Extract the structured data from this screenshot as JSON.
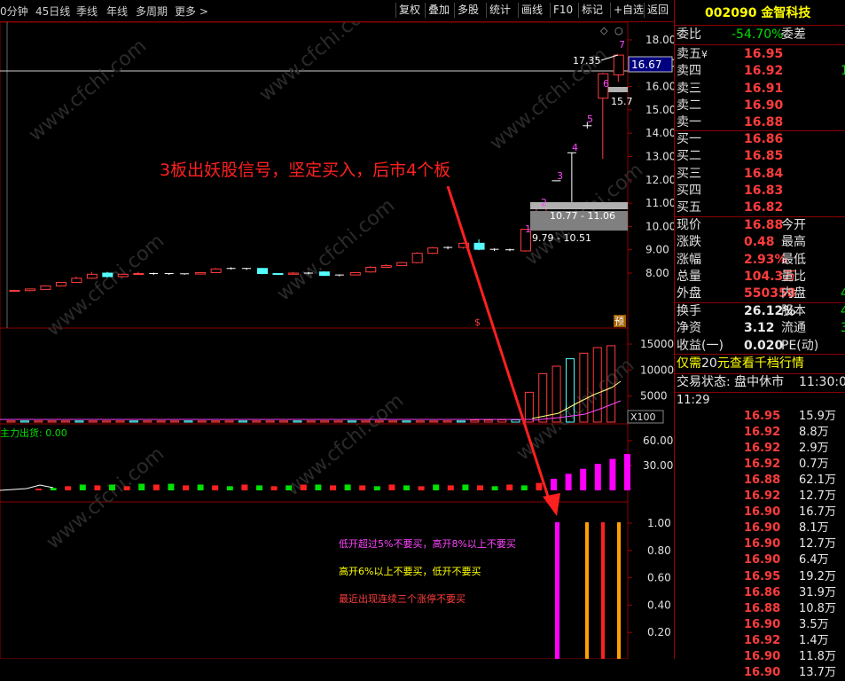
{
  "toolbar": {
    "left": [
      "0分钟",
      "45日线",
      "季线",
      "年线",
      "多周期",
      "更多"
    ],
    "right": [
      "复权",
      "叠加",
      "多股",
      "统计",
      "画线",
      "F10",
      "标记",
      "+自选",
      "返回"
    ]
  },
  "price_axis": [
    "18.00",
    "17.00",
    "16.00",
    "15.00",
    "14.00",
    "13.00",
    "12.00",
    "11.00",
    "10.00",
    "9.00",
    "8.00"
  ],
  "price_label": "16.67",
  "annotations": {
    "high_label": "17.35",
    "partial_label": "15.7",
    "box1": "10.77 - 11.06",
    "box2": "9.79 - 10.51",
    "nums": [
      "1",
      "2",
      "3",
      "4",
      "5",
      "6",
      "7"
    ],
    "main_text": "3板出妖股信号，坚定买入，后市4个板",
    "s_mark": "$",
    "yu_mark": "预"
  },
  "vol_axis": [
    "15000",
    "10000",
    "5000"
  ],
  "vol_unit": "X100",
  "flow_title": "主力出货: 0.00",
  "flow_axis": [
    "60.00",
    "30.00"
  ],
  "sig_axis": [
    "1.00",
    "0.80",
    "0.60",
    "0.40",
    "0.20"
  ],
  "notes": [
    "低开超过5%不要买，高开8%以上不要买",
    "高开6%以上不要买，低开不要买",
    "最近出现连续三个涨停不要买"
  ],
  "watermark": "www.cfchi.com",
  "stock": {
    "code": "002090",
    "name": "金智科技"
  },
  "weibi": {
    "label": "委比",
    "value": "-54.70%",
    "label2": "委差"
  },
  "asks": [
    {
      "label": "卖五",
      "mark": "¥",
      "price": "16.95"
    },
    {
      "label": "卖四",
      "price": "16.92",
      "extra": "1"
    },
    {
      "label": "卖三",
      "price": "16.91"
    },
    {
      "label": "卖二",
      "price": "16.90"
    },
    {
      "label": "卖一",
      "price": "16.88"
    }
  ],
  "bids": [
    {
      "label": "买一",
      "price": "16.86"
    },
    {
      "label": "买二",
      "price": "16.85"
    },
    {
      "label": "买三",
      "price": "16.84"
    },
    {
      "label": "买四",
      "price": "16.83"
    },
    {
      "label": "买五",
      "price": "16.82"
    }
  ],
  "quote": [
    {
      "l": "现价",
      "v": "16.88",
      "r": "今开"
    },
    {
      "l": "涨跌",
      "v": "0.48",
      "r": "最高"
    },
    {
      "l": "涨幅",
      "v": "2.93%",
      "r": "最低"
    },
    {
      "l": "总量",
      "v": "104.3万",
      "r": "量比"
    },
    {
      "l": "外盘",
      "v": "550358",
      "r": "内盘",
      "extra": "4"
    }
  ],
  "stats": [
    {
      "l": "换手",
      "v": "26.12%",
      "r": "股本",
      "extra": "4"
    },
    {
      "l": "净资",
      "v": "3.12",
      "r": "流通",
      "extra": "3"
    },
    {
      "l": "收益(一)",
      "v": "0.020",
      "r": "PE(动)"
    }
  ],
  "promo": {
    "pre": "仅需",
    "num": "20",
    "post": "元查看千档行情"
  },
  "trade_status": {
    "label": "交易状态: 盘中休市",
    "time": "11:30:00"
  },
  "ticks_time": "11:29",
  "ticks": [
    {
      "p": "16.95",
      "v": "15.9万"
    },
    {
      "p": "16.92",
      "v": "8.8万"
    },
    {
      "p": "16.92",
      "v": "2.9万"
    },
    {
      "p": "16.92",
      "v": "0.7万"
    },
    {
      "p": "16.88",
      "v": "62.1万"
    },
    {
      "p": "16.92",
      "v": "12.7万"
    },
    {
      "p": "16.90",
      "v": "16.7万"
    },
    {
      "p": "16.90",
      "v": "8.1万"
    },
    {
      "p": "16.90",
      "v": "12.7万"
    },
    {
      "p": "16.90",
      "v": "6.4万"
    },
    {
      "p": "16.95",
      "v": "19.2万"
    },
    {
      "p": "16.86",
      "v": "31.9万"
    },
    {
      "p": "16.88",
      "v": "10.8万"
    },
    {
      "p": "16.90",
      "v": "3.5万"
    },
    {
      "p": "16.92",
      "v": "1.4万"
    },
    {
      "p": "16.90",
      "v": "11.8万"
    },
    {
      "p": "16.90",
      "v": "13.7万"
    }
  ],
  "chart_data": {
    "type": "candlestick",
    "ylim": [
      7.6,
      18.3
    ],
    "candles": [
      {
        "o": 7.22,
        "c": 7.26,
        "h": 7.28,
        "l": 7.2
      },
      {
        "o": 7.25,
        "c": 7.32,
        "h": 7.34,
        "l": 7.22
      },
      {
        "o": 7.3,
        "c": 7.45,
        "h": 7.48,
        "l": 7.28
      },
      {
        "o": 7.45,
        "c": 7.6,
        "h": 7.62,
        "l": 7.42
      },
      {
        "o": 7.6,
        "c": 7.78,
        "h": 7.85,
        "l": 7.58
      },
      {
        "o": 7.78,
        "c": 7.95,
        "h": 8.05,
        "l": 7.75
      },
      {
        "o": 8.0,
        "c": 7.85,
        "h": 8.05,
        "l": 7.8
      },
      {
        "o": 7.85,
        "c": 7.95,
        "h": 7.98,
        "l": 7.82
      },
      {
        "o": 7.95,
        "c": 7.98,
        "h": 8.05,
        "l": 7.92
      },
      {
        "o": 7.98,
        "c": 7.96,
        "h": 8.02,
        "l": 7.92
      },
      {
        "o": 7.96,
        "c": 7.98,
        "h": 8.0,
        "l": 7.92
      },
      {
        "o": 7.95,
        "c": 7.97,
        "h": 7.98,
        "l": 7.93
      },
      {
        "o": 7.96,
        "c": 8.02,
        "h": 8.04,
        "l": 7.94
      },
      {
        "o": 8.02,
        "c": 8.18,
        "h": 8.22,
        "l": 8.0
      },
      {
        "o": 8.18,
        "c": 8.2,
        "h": 8.25,
        "l": 8.15
      },
      {
        "o": 8.2,
        "c": 8.18,
        "h": 8.22,
        "l": 8.14
      },
      {
        "o": 8.2,
        "c": 7.98,
        "h": 8.22,
        "l": 7.95
      },
      {
        "o": 7.98,
        "c": 7.95,
        "h": 8.0,
        "l": 7.92
      },
      {
        "o": 7.95,
        "c": 8.0,
        "h": 8.05,
        "l": 7.93
      },
      {
        "o": 8.0,
        "c": 7.98,
        "h": 8.04,
        "l": 7.94
      },
      {
        "o": 8.05,
        "c": 7.9,
        "h": 8.08,
        "l": 7.88
      },
      {
        "o": 7.92,
        "c": 7.9,
        "h": 7.94,
        "l": 7.86
      },
      {
        "o": 7.92,
        "c": 8.02,
        "h": 8.05,
        "l": 7.9
      },
      {
        "o": 8.05,
        "c": 8.25,
        "h": 8.3,
        "l": 8.02
      },
      {
        "o": 8.25,
        "c": 8.32,
        "h": 8.38,
        "l": 8.22
      },
      {
        "o": 8.32,
        "c": 8.45,
        "h": 8.48,
        "l": 8.3
      },
      {
        "o": 8.45,
        "c": 8.85,
        "h": 8.9,
        "l": 8.42
      },
      {
        "o": 8.85,
        "c": 9.08,
        "h": 9.12,
        "l": 8.82
      },
      {
        "o": 9.08,
        "c": 9.1,
        "h": 9.15,
        "l": 9.02
      },
      {
        "o": 9.1,
        "c": 9.28,
        "h": 9.32,
        "l": 9.05
      },
      {
        "o": 9.28,
        "c": 9.02,
        "h": 9.45,
        "l": 8.98
      },
      {
        "o": 9.02,
        "c": 9.0,
        "h": 9.06,
        "l": 8.95
      },
      {
        "o": 9.0,
        "c": 8.98,
        "h": 9.05,
        "l": 8.94
      },
      {
        "o": 8.95,
        "c": 9.88,
        "h": 9.88,
        "l": 8.92
      },
      {
        "o": 10.6,
        "c": 10.87,
        "h": 10.87,
        "l": 10.55
      },
      {
        "o": 11.95,
        "c": 11.96,
        "h": 11.96,
        "l": 11.94
      },
      {
        "o": 13.15,
        "c": 13.16,
        "h": 13.16,
        "l": 11.05
      },
      {
        "o": 14.3,
        "c": 14.32,
        "h": 14.48,
        "l": 14.2
      },
      {
        "o": 15.5,
        "c": 16.55,
        "h": 16.6,
        "l": 12.9
      },
      {
        "o": 16.5,
        "c": 17.35,
        "h": 17.35,
        "l": 16.2
      }
    ],
    "volume": [
      3,
      3,
      3,
      3,
      3,
      3,
      3,
      3,
      3,
      3,
      3,
      3,
      3,
      3,
      3,
      3,
      3,
      3,
      3,
      3,
      3,
      3,
      3,
      3,
      3,
      3,
      3,
      3,
      3,
      3,
      3,
      3,
      3,
      3,
      5,
      5,
      6,
      6,
      80,
      130,
      150,
      170,
      185,
      200,
      205
    ],
    "flow": [
      2,
      3,
      5,
      7,
      6,
      7,
      5,
      8,
      7,
      8,
      6,
      7,
      6,
      5,
      7,
      6,
      5,
      6,
      7,
      7,
      6,
      7,
      6,
      5,
      7,
      6,
      5,
      7,
      6,
      7,
      6,
      5,
      7,
      6,
      9,
      14,
      20,
      26,
      32,
      38,
      44
    ]
  }
}
